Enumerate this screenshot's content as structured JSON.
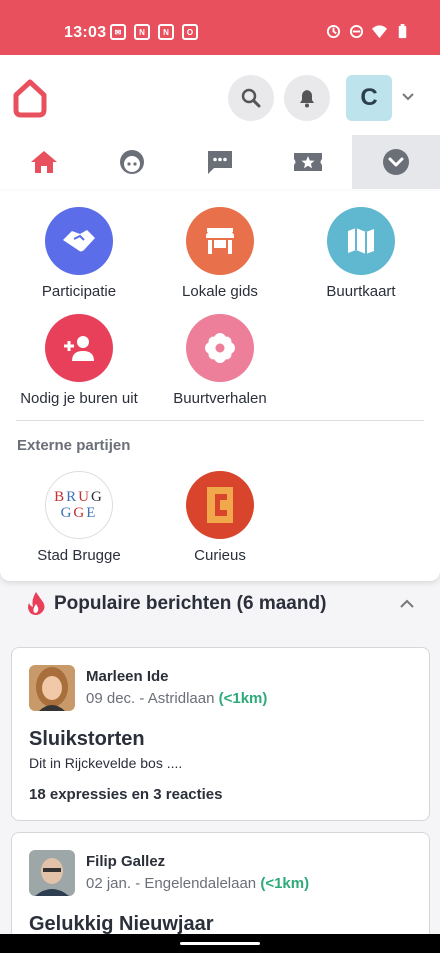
{
  "status_bar": {
    "time": "13:03",
    "left_icons": [
      "mail-icon",
      "news-icon",
      "news-icon",
      "outlook-icon"
    ],
    "right_icons": [
      "sync-icon",
      "dnd-icon",
      "wifi-icon",
      "battery-icon"
    ]
  },
  "header": {
    "avatar_initial": "C"
  },
  "colors": {
    "brand": "#e8505e",
    "participatie": "#5b6de8",
    "lokale_gids": "#e8704a",
    "buurtkaart": "#5fb8cf",
    "nodig": "#e8405a",
    "buurtverhalen": "#ee7f9a",
    "distance": "#2eaa7a"
  },
  "menu": {
    "items": [
      {
        "label": "Participatie",
        "icon": "handshake-icon"
      },
      {
        "label": "Lokale gids",
        "icon": "store-icon"
      },
      {
        "label": "Buurtkaart",
        "icon": "map-icon"
      },
      {
        "label": "Nodig je buren uit",
        "icon": "add-person-icon"
      },
      {
        "label": "Buurtverhalen",
        "icon": "flower-icon"
      }
    ],
    "external_title": "Externe partijen",
    "external": [
      {
        "label": "Stad Brugge",
        "logo_rows": [
          "BRUG",
          "GE"
        ]
      },
      {
        "label": "Curieus",
        "logo_letter": "C"
      }
    ]
  },
  "popular": {
    "title": "Populaire berichten (6 maand)",
    "posts": [
      {
        "author": "Marleen Ide",
        "date": "09 dec.",
        "street": "- Astridlaan",
        "distance": "(<1km)",
        "title": "Sluikstorten",
        "excerpt": "Dit in Rijckevelde bos ....",
        "stats": "18 expressies en 3 reacties"
      },
      {
        "author": "Filip Gallez",
        "date": "02 jan.",
        "street": "- Engelendalelaan",
        "distance": "(<1km)",
        "title": "Gelukkig Nieuwjaar"
      }
    ]
  }
}
